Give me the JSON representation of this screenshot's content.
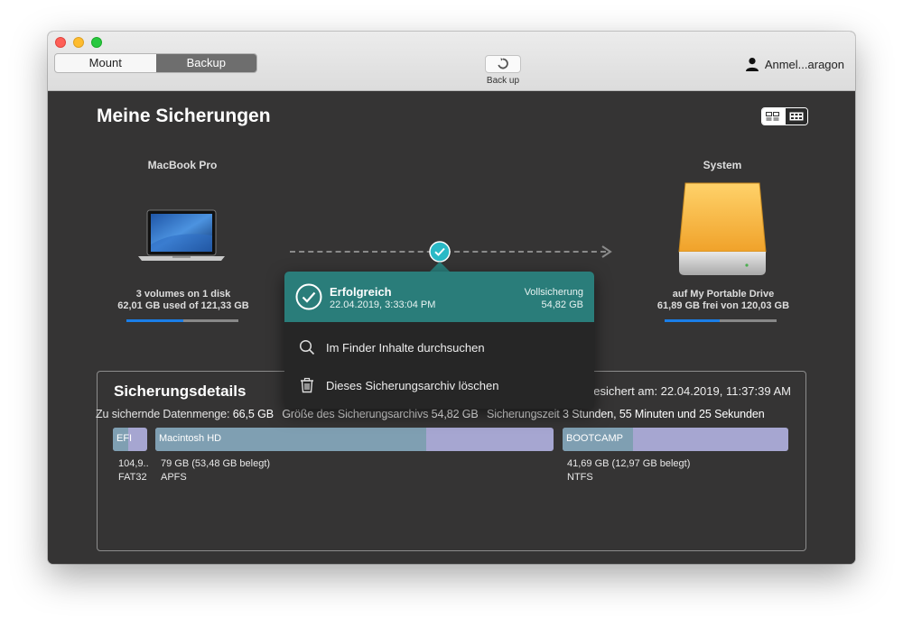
{
  "toolbar": {
    "tabs": [
      "Mount",
      "Backup"
    ],
    "backup_button_label": "Back up",
    "user_label": "Anmel...aragon"
  },
  "main": {
    "title": "Meine Sicherungen",
    "source": {
      "name": "MacBook Pro",
      "line1": "3 volumes on 1 disk",
      "line2": "62,01 GB used of 121,33 GB",
      "usage_fraction": 0.51
    },
    "destination": {
      "name": "System",
      "line1": "auf My Portable Drive",
      "line2": "61,89 GB frei von 120,03 GB",
      "usage_fraction": 0.49
    }
  },
  "popup": {
    "status": "Erfolgreich",
    "date": "22.04.2019, 3:33:04 PM",
    "type": "Vollsicherung",
    "size": "54,82 GB",
    "actions": [
      "Im Finder Inhalte durchsuchen",
      "Dieses Sicherungsarchiv löschen"
    ]
  },
  "details": {
    "title": "Sicherungsdetails",
    "saved_at": "esichert am: 22.04.2019, 11:37:39 AM",
    "data_amount_label": "Zu sichernde Datenmenge:",
    "data_amount_value": "66,5 GB",
    "archive_size_label": "Größe des Sicherungsarchivs",
    "archive_size_value": "54,82 GB",
    "duration_label": "Sicherungszeit",
    "duration_value": "3 Stunden, 55 Minuten und 25 Sekunden",
    "partitions": [
      {
        "name": "EFI",
        "size": "104,9..",
        "fs": "FAT32",
        "used_fraction": 0.45
      },
      {
        "name": "Macintosh HD",
        "size": "79 GB (53,48 GB belegt)",
        "fs": "APFS",
        "used_fraction": 0.68
      },
      {
        "name": "BOOTCAMP",
        "size": "41,69 GB (12,97 GB belegt)",
        "fs": "NTFS",
        "used_fraction": 0.31
      }
    ]
  },
  "colors": {
    "accent_teal": "#2a7d7a",
    "usage_bar": "#1a7ee8",
    "partition_used": "#7f9fb2",
    "partition_free": "#a6a6d1"
  }
}
